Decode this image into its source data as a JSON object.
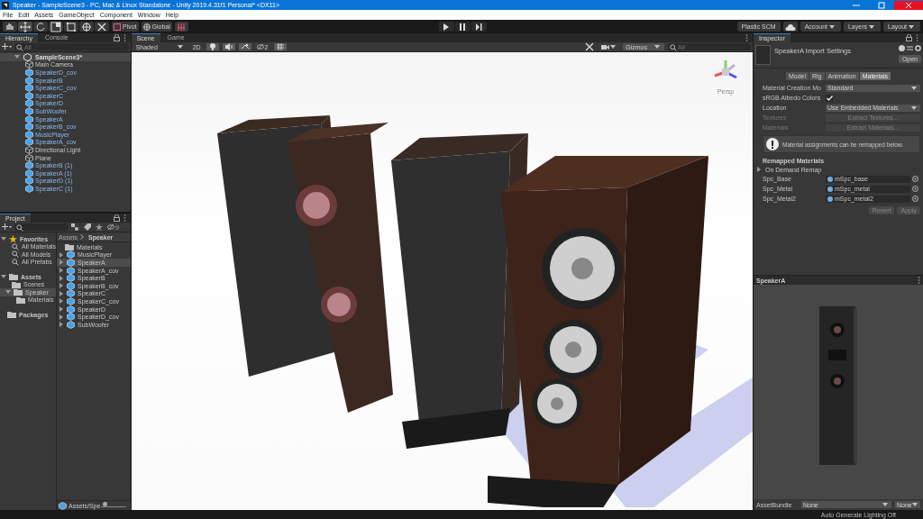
{
  "window": {
    "title": "Speaker - SampleScene3 - PC, Mac & Linux Standalone - Unity 2019.4.31f1 Personal* <DX11>"
  },
  "menu": [
    "File",
    "Edit",
    "Assets",
    "GameObject",
    "Component",
    "Window",
    "Help"
  ],
  "toolbar": {
    "pivot": "Pivot",
    "global": "Global",
    "right": [
      "Plastic SCM",
      "Account",
      "Layers",
      "Layout"
    ]
  },
  "hierarchy": {
    "tabs": [
      {
        "label": "Hierarchy",
        "selected": true
      },
      {
        "label": "Console",
        "selected": false
      }
    ],
    "search": {
      "placeholder": "All"
    },
    "scene": "SampleScene3*",
    "items": [
      {
        "label": "Main Camera",
        "kind": "object"
      },
      {
        "label": "SpeakerD_cov",
        "kind": "prefab"
      },
      {
        "label": "SpeakerB",
        "kind": "prefab"
      },
      {
        "label": "SpeakerC_cov",
        "kind": "prefab"
      },
      {
        "label": "SpeakerC",
        "kind": "prefab"
      },
      {
        "label": "SpeakerD",
        "kind": "prefab"
      },
      {
        "label": "SubWoofer",
        "kind": "prefab"
      },
      {
        "label": "SpeakerA",
        "kind": "prefab"
      },
      {
        "label": "SpeakerB_cov",
        "kind": "prefab"
      },
      {
        "label": "MusicPlayer",
        "kind": "prefab"
      },
      {
        "label": "SpeakerA_cov",
        "kind": "prefab"
      },
      {
        "label": "Directional Light",
        "kind": "object"
      },
      {
        "label": "Plane",
        "kind": "object"
      },
      {
        "label": "SpeakerB (1)",
        "kind": "prefab"
      },
      {
        "label": "SpeakerA (1)",
        "kind": "prefab"
      },
      {
        "label": "SpeakerD (1)",
        "kind": "prefab"
      },
      {
        "label": "SpeakerC (1)",
        "kind": "prefab"
      }
    ]
  },
  "project": {
    "tab": "Project",
    "hidden_count": "9",
    "tree": [
      {
        "label": "Favorites",
        "kind": "favorites",
        "children": [
          {
            "label": "All Materials",
            "kind": "search"
          },
          {
            "label": "All Models",
            "kind": "search"
          },
          {
            "label": "All Prefabs",
            "kind": "search"
          }
        ]
      },
      {
        "label": "Assets",
        "kind": "folder",
        "children": [
          {
            "label": "Scenes",
            "kind": "folder"
          },
          {
            "label": "Speaker",
            "kind": "folder",
            "selected": true,
            "children": [
              {
                "label": "Materials",
                "kind": "folder"
              }
            ]
          }
        ]
      },
      {
        "label": "Packages",
        "kind": "folder"
      }
    ],
    "breadcrumb": [
      "Assets",
      "Speaker"
    ],
    "assets": [
      {
        "label": "Materials",
        "kind": "folder",
        "selected": false
      },
      {
        "label": "MusicPlayer",
        "kind": "prefab",
        "selected": false
      },
      {
        "label": "SpeakerA",
        "kind": "prefab",
        "selected": true
      },
      {
        "label": "SpeakerA_cov",
        "kind": "prefab",
        "selected": false
      },
      {
        "label": "SpeakerB",
        "kind": "prefab",
        "selected": false
      },
      {
        "label": "SpeakerB_cov",
        "kind": "prefab",
        "selected": false
      },
      {
        "label": "SpeakerC",
        "kind": "prefab",
        "selected": false
      },
      {
        "label": "SpeakerC_cov",
        "kind": "prefab",
        "selected": false
      },
      {
        "label": "SpeakerD",
        "kind": "prefab",
        "selected": false
      },
      {
        "label": "SpeakerD_cov",
        "kind": "prefab",
        "selected": false
      },
      {
        "label": "SubWoofer",
        "kind": "prefab",
        "selected": false
      }
    ],
    "path": "Assets/Spe",
    "icon_size": {
      "level": 0.05
    }
  },
  "scene": {
    "tabs": [
      {
        "label": "Scene",
        "selected": true
      },
      {
        "label": "Game",
        "selected": false
      }
    ],
    "shading": "Shaded",
    "mode_2d": "2D",
    "toggles": [
      {
        "kind": "lighting",
        "on": true
      },
      {
        "kind": "audio",
        "on": true
      },
      {
        "kind": "effects",
        "on": true
      }
    ],
    "hidden_count": "2",
    "grid": {
      "on": true
    },
    "gizmos": "Gizmos",
    "search": {
      "placeholder": "All"
    },
    "view_label": "Persp"
  },
  "inspector": {
    "tab": "Inspector",
    "title": "SpeakerA Import Settings",
    "open": "Open",
    "tabs": [
      {
        "label": "Model",
        "selected": false
      },
      {
        "label": "Rig",
        "selected": false
      },
      {
        "label": "Animation",
        "selected": false
      },
      {
        "label": "Materials",
        "selected": true
      }
    ],
    "fields": [
      {
        "kind": "dropdown",
        "label": "Material Creation Mo",
        "value": "Standard"
      },
      {
        "kind": "checkbox",
        "label": "sRGB Albedo Colors",
        "checked": true
      },
      {
        "kind": "dropdown",
        "label": "Location",
        "value": "Use Embedded Materials"
      },
      {
        "kind": "button",
        "label": "Textures",
        "value": "Extract Textures...",
        "disabled": true
      },
      {
        "kind": "button",
        "label": "Materials",
        "value": "Extract Materials...",
        "disabled": true
      }
    ],
    "info": "Material assignments can be remapped below.",
    "remapped_title": "Remapped Materials",
    "on_demand": {
      "label": "On Demand Remap",
      "expanded": false
    },
    "remaps": [
      {
        "label": "Spc_Base",
        "value": "mSpc_base"
      },
      {
        "label": "Spc_Metal",
        "value": "mSpc_metal"
      },
      {
        "label": "Spc_Metal2",
        "value": "mSpc_metal2"
      }
    ],
    "buttons": [
      "Revert",
      "Apply"
    ],
    "preview_title": "SpeakerA",
    "asset_bundle": {
      "label": "AssetBundle",
      "name": "None",
      "variant": "None"
    }
  },
  "status_bar": "Auto Generate Lighting Off"
}
